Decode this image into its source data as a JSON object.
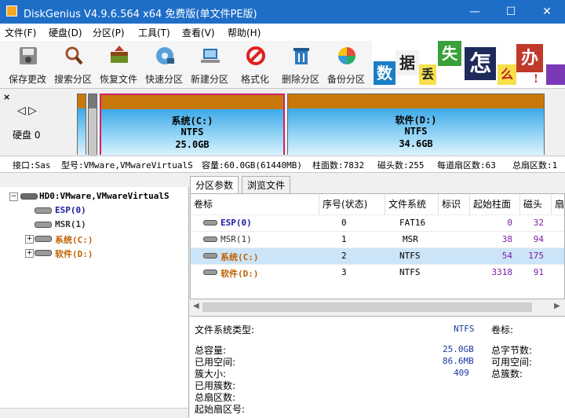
{
  "window": {
    "title": "DiskGenius V4.9.6.564 x64 免费版(单文件PE版)",
    "minimize": "—",
    "maximize": "☐",
    "close": "✕"
  },
  "menu": [
    "文件(F)",
    "硬盘(D)",
    "分区(P)",
    "工具(T)",
    "查看(V)",
    "帮助(H)"
  ],
  "toolbar": [
    {
      "label": "保存更改",
      "icon": "save-disk-icon"
    },
    {
      "label": "搜索分区",
      "icon": "magnifier-icon"
    },
    {
      "label": "恢复文件",
      "icon": "recover-box-icon"
    },
    {
      "label": "快速分区",
      "icon": "disk-quick-icon"
    },
    {
      "label": "新建分区",
      "icon": "laptop-icon"
    },
    {
      "label": "格式化",
      "icon": "format-red-icon"
    },
    {
      "label": "删除分区",
      "icon": "trash-icon"
    },
    {
      "label": "备份分区",
      "icon": "pie-backup-icon"
    }
  ],
  "banner": [
    "数",
    "据",
    "丢",
    "失",
    "怎",
    "么",
    "办",
    "!"
  ],
  "disk_nav": {
    "label": "硬盘 0",
    "prev": "◁",
    "next": "▷"
  },
  "partitions_bar": [
    {
      "name": "系统(C:)",
      "fs": "NTFS",
      "size": "25.0GB"
    },
    {
      "name": "软件(D:)",
      "fs": "NTFS",
      "size": "34.6GB"
    }
  ],
  "disk_info": {
    "interface": "接口:Sas",
    "model": "型号:VMware,VMwareVirtualS",
    "capacity": "容量:60.0GB(61440MB)",
    "cylinders": "柱面数:7832",
    "heads": "磁头数:255",
    "sectors_per_track": "每道扇区数:63",
    "total_sectors": "总扇区数:1"
  },
  "tree": {
    "disk": "HD0:VMware,VMwareVirtualS",
    "items": [
      {
        "label": "ESP(0)",
        "color": "#1a1aa0"
      },
      {
        "label": "MSR(1)",
        "color": "#333333"
      },
      {
        "label": "系统(C:)",
        "color": "#c06000"
      },
      {
        "label": "软件(D:)",
        "color": "#c06000"
      }
    ]
  },
  "tabs": [
    "分区参数",
    "浏览文件"
  ],
  "table": {
    "headers": [
      "卷标",
      "序号(状态)",
      "文件系统",
      "标识",
      "起始柱面",
      "磁头",
      "扇"
    ],
    "rows": [
      {
        "label": "ESP(0)",
        "index": "0",
        "fs": "FAT16",
        "id": "",
        "start_cyl": "0",
        "head": "32",
        "color": "#1a1aa0"
      },
      {
        "label": "MSR(1)",
        "index": "1",
        "fs": "MSR",
        "id": "",
        "start_cyl": "38",
        "head": "94",
        "color": "#333333"
      },
      {
        "label": "系统(C:)",
        "index": "2",
        "fs": "NTFS",
        "id": "",
        "start_cyl": "54",
        "head": "175",
        "color": "#c06000"
      },
      {
        "label": "软件(D:)",
        "index": "3",
        "fs": "NTFS",
        "id": "",
        "start_cyl": "3318",
        "head": "91",
        "color": "#c06000"
      }
    ]
  },
  "details": {
    "fs_type_label": "文件系统类型:",
    "fs_type_value": "NTFS",
    "volume_label": "卷标:",
    "total_capacity_label": "总容量:",
    "total_capacity_value": "25.0GB",
    "total_bytes_label": "总字节数:",
    "used_space_label": "已用空间:",
    "used_space_value": "86.6MB",
    "free_space_label": "可用空间:",
    "cluster_size_label": "簇大小:",
    "cluster_size_value": "409",
    "total_clusters_label": "总簇数:",
    "used_clusters_label": "已用簇数:",
    "total_sectors_label": "总扇区数:",
    "start_sector_label": "起始扇区号:"
  }
}
